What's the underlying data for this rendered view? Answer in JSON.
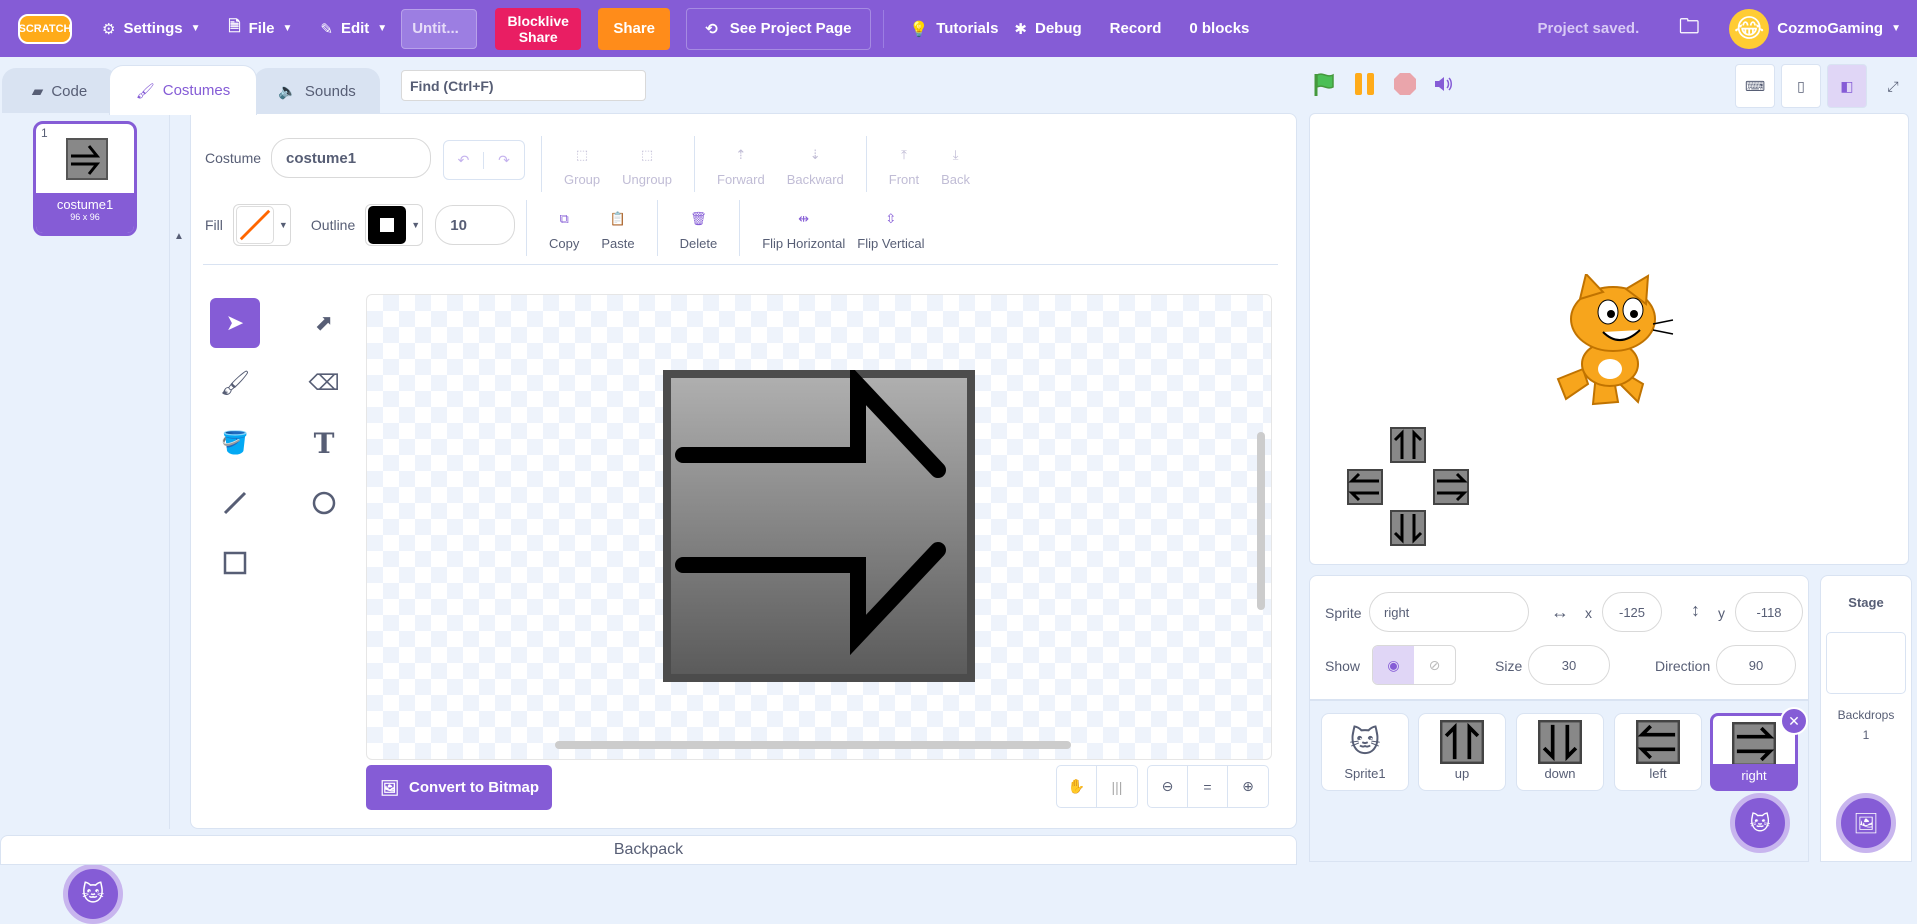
{
  "menu": {
    "logo": "SCRATCH",
    "settings": "Settings",
    "file": "File",
    "edit": "Edit",
    "title": "Untit...",
    "blocklive_share_1": "Blocklive",
    "blocklive_share_2": "Share",
    "share": "Share",
    "see_project": "See Project Page",
    "tutorials": "Tutorials",
    "debug": "Debug",
    "record": "Record",
    "blocks": "0 blocks",
    "status": "Project saved.",
    "username": "CozmoGaming"
  },
  "tabs": {
    "code": "Code",
    "costumes": "Costumes",
    "sounds": "Sounds"
  },
  "find_placeholder": "Find (Ctrl+F)",
  "costume_list": [
    {
      "number": "1",
      "name": "costume1",
      "size": "96 x 96"
    }
  ],
  "editor": {
    "costume_label": "Costume",
    "costume_name": "costume1",
    "group": "Group",
    "ungroup": "Ungroup",
    "forward": "Forward",
    "backward": "Backward",
    "front": "Front",
    "back": "Back",
    "fill_label": "Fill",
    "fill_color": "#ff6600",
    "outline_label": "Outline",
    "outline_color": "#000000",
    "outline_width": "10",
    "copy": "Copy",
    "paste": "Paste",
    "delete": "Delete",
    "flip_h": "Flip Horizontal",
    "flip_v": "Flip Vertical",
    "convert": "Convert to Bitmap"
  },
  "tools": [
    "select-tool",
    "reshape-tool",
    "brush-tool",
    "eraser-tool",
    "fill-tool",
    "text-tool",
    "line-tool",
    "circle-tool",
    "rectangle-tool"
  ],
  "backpack": "Backpack",
  "sprite_info": {
    "sprite_label": "Sprite",
    "sprite_name": "right",
    "x_label": "x",
    "x": "-125",
    "y_label": "y",
    "y": "-118",
    "show_label": "Show",
    "size_label": "Size",
    "size": "30",
    "direction_label": "Direction",
    "direction": "90"
  },
  "sprites": [
    {
      "name": "Sprite1",
      "icon": "cat-icon"
    },
    {
      "name": "up",
      "icon": "up-arrow-icon"
    },
    {
      "name": "down",
      "icon": "down-arrow-icon"
    },
    {
      "name": "left",
      "icon": "left-arrow-icon"
    },
    {
      "name": "right",
      "icon": "right-arrow-icon",
      "selected": true
    }
  ],
  "stage_panel": {
    "title": "Stage",
    "backdrops_label": "Backdrops",
    "backdrops_count": "1"
  },
  "colors": {
    "accent": "#855cd6",
    "share": "#ff8c1a",
    "blocklive": "#e91e63"
  }
}
